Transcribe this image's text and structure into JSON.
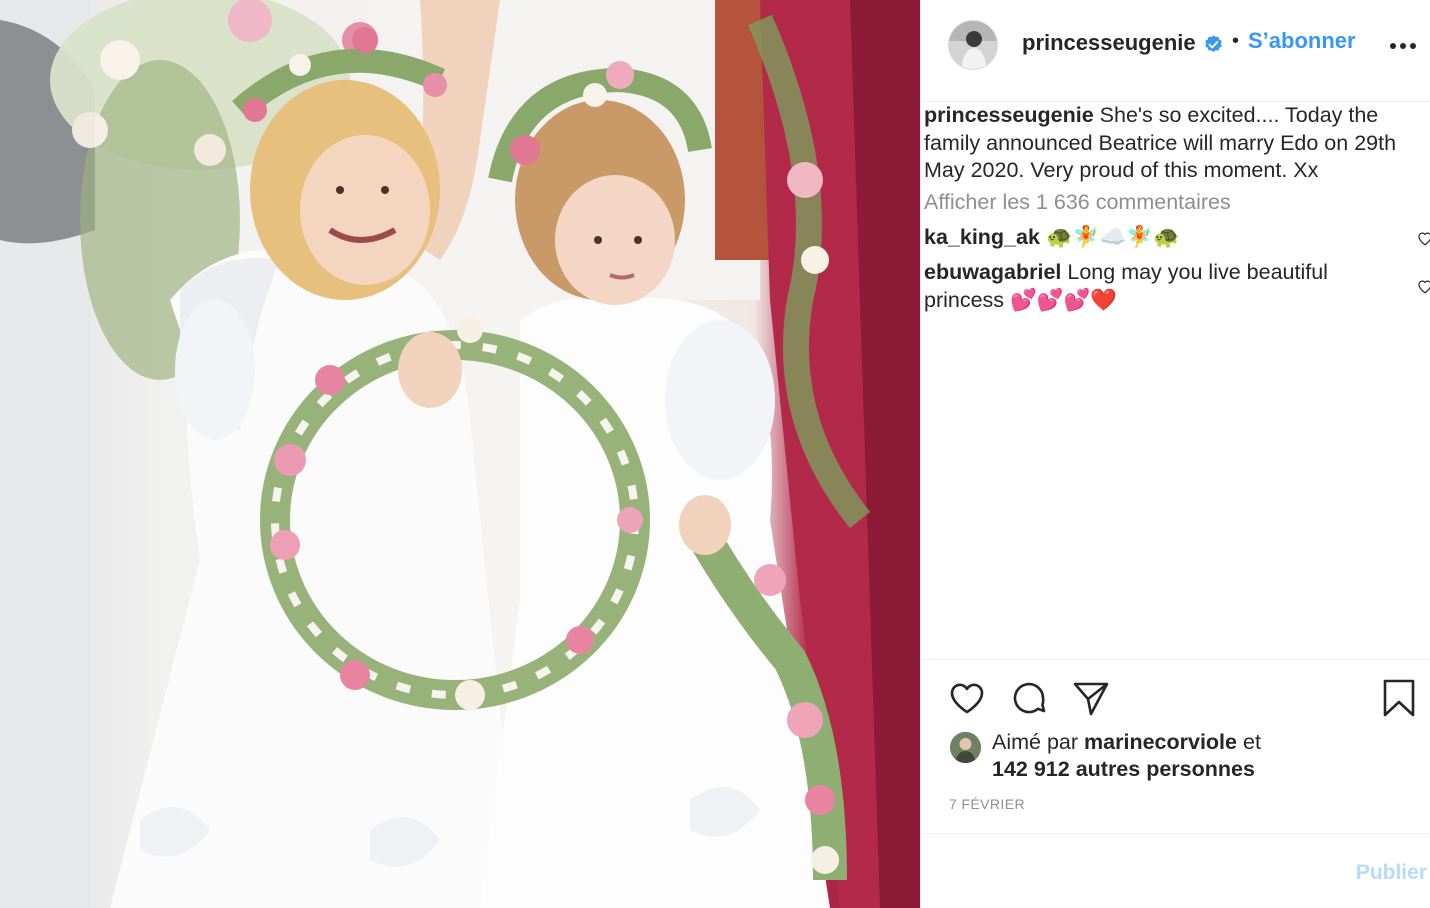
{
  "post": {
    "username": "princesseugenie",
    "separator": "•",
    "follow_label": "S’abonner",
    "caption_user": "princesseugenie",
    "caption_text": "She's so excited.... Today the family announced Beatrice will marry Edo on 29th May 2020. Very proud of this moment. Xx",
    "view_comments_label": "Afficher les 1 636 commentaires"
  },
  "comments": [
    {
      "user": "ka_king_ak",
      "text": "🐢🧚☁️🧚🐢"
    },
    {
      "user": "ebuwagabriel",
      "text": "Long may you live beautiful princess 💕💕💕❤️"
    }
  ],
  "likes": {
    "prefix": "Aimé par",
    "user": "marinecorviole",
    "conj": "et",
    "others": "142 912 autres personnes"
  },
  "date": "7 FÉVRIER",
  "composer": {
    "publish_label": "Publier"
  },
  "icons": [
    "verified-badge-icon",
    "more-options-icon",
    "like-heart-icon",
    "comment-icon",
    "share-icon",
    "bookmark-icon",
    "comment-like-icon"
  ],
  "colors": {
    "link_blue": "#3897f0",
    "publish_disabled": "#b9dbfb",
    "muted_gray": "#8e8e8e",
    "text": "#262626"
  }
}
